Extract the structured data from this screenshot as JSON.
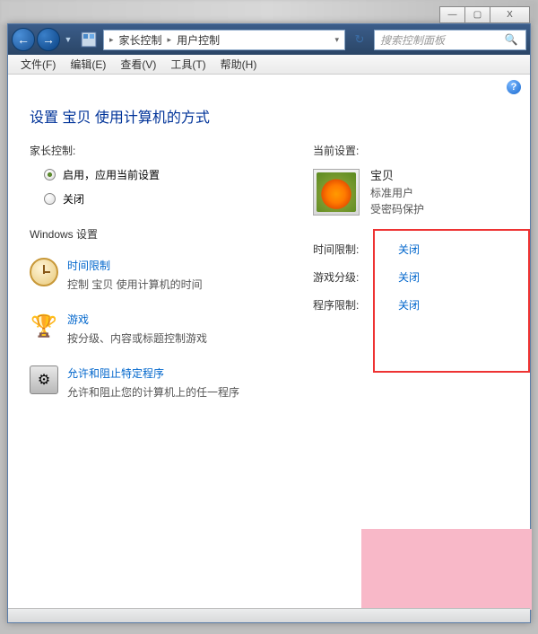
{
  "titlebar": {
    "minimize": "—",
    "maximize": "▢",
    "close": "X"
  },
  "nav": {
    "back": "←",
    "forward": "→",
    "dropdown": "▼"
  },
  "breadcrumb": {
    "item1": "家长控制",
    "item2": "用户控制",
    "arrow": "▸",
    "final_arrow": "▾"
  },
  "refresh_icon": "↻",
  "search": {
    "placeholder": "搜索控制面板",
    "icon": "🔍"
  },
  "menu": {
    "file": "文件(F)",
    "edit": "编辑(E)",
    "view": "查看(V)",
    "tools": "工具(T)",
    "help": "帮助(H)"
  },
  "help_glyph": "?",
  "page_title": "设置 宝贝 使用计算机的方式",
  "parental": {
    "label": "家长控制:",
    "opt_on": "启用，应用当前设置",
    "opt_off": "关闭"
  },
  "win_settings_label": "Windows 设置",
  "settings": [
    {
      "link": "时间限制",
      "desc": "控制 宝贝 使用计算机的时间",
      "icon": "clock"
    },
    {
      "link": "游戏",
      "desc": "按分级、内容或标题控制游戏",
      "icon": "game"
    },
    {
      "link": "允许和阻止特定程序",
      "desc": "允许和阻止您的计算机上的任一程序",
      "icon": "prog"
    }
  ],
  "game_glyph": "🏆",
  "prog_glyph": "⚙",
  "current": {
    "label": "当前设置:",
    "user_name": "宝贝",
    "user_type": "标准用户",
    "user_protect": "受密码保护"
  },
  "status": [
    {
      "label": "时间限制:",
      "value": "关闭"
    },
    {
      "label": "游戏分级:",
      "value": "关闭"
    },
    {
      "label": "程序限制:",
      "value": "关闭"
    }
  ]
}
